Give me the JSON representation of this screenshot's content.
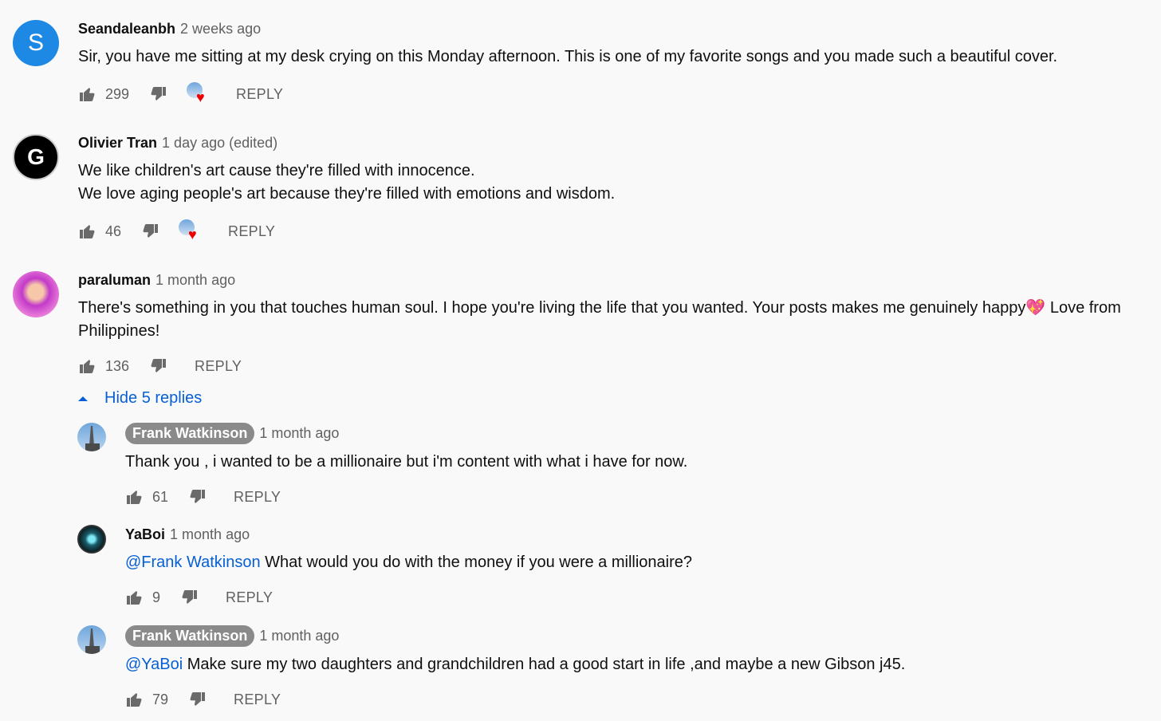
{
  "comments": [
    {
      "avatar_letter": "S",
      "author": "Seandaleanbh",
      "time": "2 weeks ago",
      "text": "Sir, you have me sitting at my desk crying on this Monday afternoon. This is one of my favorite songs and you made such a beautiful cover.",
      "likes": "299",
      "reply_label": "REPLY"
    },
    {
      "avatar_letter": "G",
      "author": "Olivier Tran",
      "time": "1 day ago (edited)",
      "text": "We like children's art cause they're filled with innocence.\nWe love aging people's art because they're filled with emotions and wisdom.",
      "likes": "46",
      "reply_label": "REPLY"
    },
    {
      "author": "paraluman",
      "time": "1 month ago",
      "text": "There's something in you that touches human soul. I hope you're living the life that you wanted. Your posts makes me genuinely happy💖 Love from Philippines!",
      "likes": "136",
      "reply_label": "REPLY"
    }
  ],
  "replies_toggle": "Hide 5 replies",
  "replies": [
    {
      "author": "Frank Watkinson",
      "time": "1 month ago",
      "mention": "",
      "text": "Thank you , i wanted to be a millionaire but i'm content with what i have for now.",
      "likes": "61",
      "reply_label": "REPLY"
    },
    {
      "author": "YaBoi",
      "time": "1 month ago",
      "mention": "@Frank Watkinson",
      "text": " What would you do with the money if you were a millionaire?",
      "likes": "9",
      "reply_label": "REPLY"
    },
    {
      "author": "Frank Watkinson",
      "time": "1 month ago",
      "mention": "@YaBoi",
      "text": " Make sure my two daughters and grandchildren had a good start in life ,and maybe a new Gibson j45.",
      "likes": "79",
      "reply_label": "REPLY"
    }
  ],
  "colors": {
    "background": "#f9f9f9",
    "link": "#065fd4",
    "heart": "#ee0000",
    "author_badge": "#8a8a8a"
  },
  "icons": [
    "thumbs-up-icon",
    "thumbs-down-icon",
    "heart-icon",
    "caret-up-icon"
  ]
}
